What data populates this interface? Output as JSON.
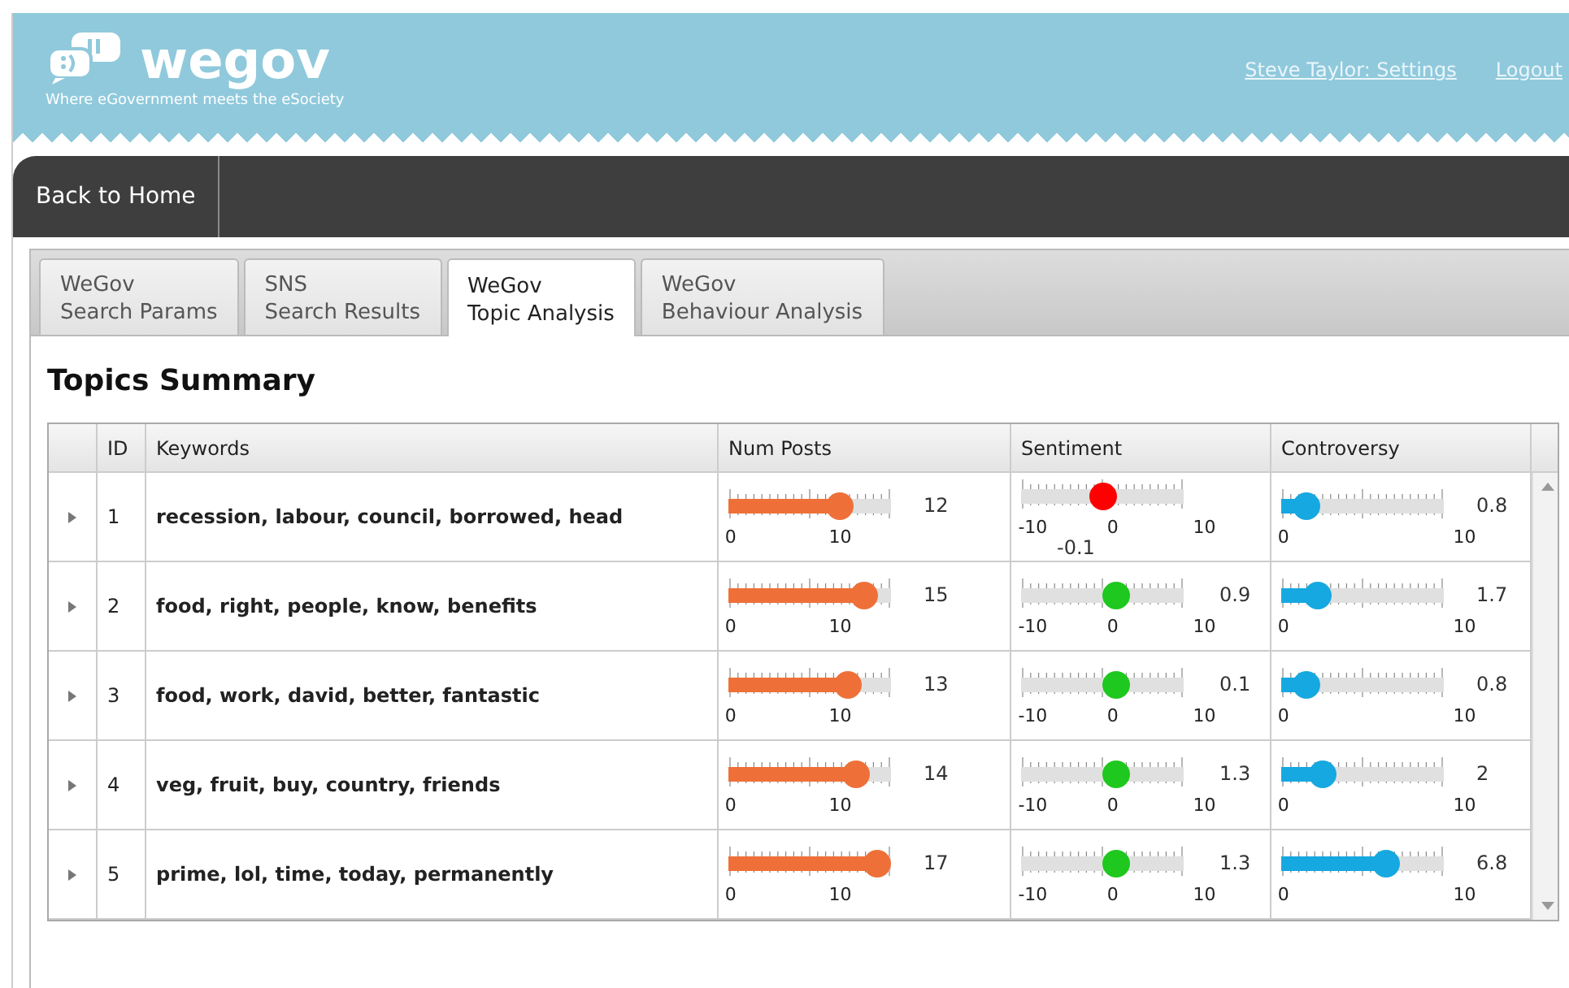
{
  "header": {
    "logo_text": "wegov",
    "tagline": "Where eGovernment meets the eSociety",
    "links": [
      "Steve Taylor: Settings",
      "Logout"
    ]
  },
  "nav": {
    "items": [
      "Back to Home"
    ]
  },
  "tabs": [
    {
      "line1": "WeGov",
      "line2": "Search Params",
      "selected": false
    },
    {
      "line1": "SNS",
      "line2": "Search Results",
      "selected": false
    },
    {
      "line1": "WeGov",
      "line2": "Topic Analysis",
      "selected": true
    },
    {
      "line1": "WeGov",
      "line2": "Behaviour Analysis",
      "selected": false
    }
  ],
  "section_title": "Topics Summary",
  "table": {
    "columns": [
      "ID",
      "Keywords",
      "Num Posts",
      "Sentiment",
      "Controversy"
    ],
    "rows": [
      {
        "expanded": false,
        "id": "1",
        "keywords": "recession, labour, council, borrowed, head",
        "num_posts": {
          "level": 0.72,
          "reading": "12",
          "tick_labels": [
            "0",
            "10"
          ]
        },
        "sentiment": {
          "level": 0.5,
          "color": "#ff0000",
          "reading": "-0.1",
          "reading_below": true,
          "tick_labels": [
            "-10",
            "0",
            "10"
          ]
        },
        "controversy": {
          "level": 0.08,
          "reading": "0.8",
          "tick_labels": [
            "0",
            "10"
          ]
        }
      },
      {
        "expanded": false,
        "id": "2",
        "keywords": "food, right, people, know, benefits",
        "num_posts": {
          "level": 0.9,
          "reading": "15",
          "tick_labels": [
            "0",
            "10"
          ]
        },
        "sentiment": {
          "level": 0.6,
          "color": "#1ec81e",
          "reading": "0.9",
          "reading_below": false,
          "tick_labels": [
            "-10",
            "0",
            "10"
          ]
        },
        "controversy": {
          "level": 0.17,
          "reading": "1.7",
          "tick_labels": [
            "0",
            "10"
          ]
        }
      },
      {
        "expanded": false,
        "id": "3",
        "keywords": "food, work, david, better, fantastic",
        "num_posts": {
          "level": 0.78,
          "reading": "13",
          "tick_labels": [
            "0",
            "10"
          ]
        },
        "sentiment": {
          "level": 0.6,
          "color": "#1ec81e",
          "reading": "0.1",
          "reading_below": false,
          "tick_labels": [
            "-10",
            "0",
            "10"
          ]
        },
        "controversy": {
          "level": 0.08,
          "reading": "0.8",
          "tick_labels": [
            "0",
            "10"
          ]
        }
      },
      {
        "expanded": false,
        "id": "4",
        "keywords": "veg, fruit, buy, country, friends",
        "num_posts": {
          "level": 0.84,
          "reading": "14",
          "tick_labels": [
            "0",
            "10"
          ]
        },
        "sentiment": {
          "level": 0.6,
          "color": "#1ec81e",
          "reading": "1.3",
          "reading_below": false,
          "tick_labels": [
            "-10",
            "0",
            "10"
          ]
        },
        "controversy": {
          "level": 0.2,
          "reading": "2",
          "tick_labels": [
            "0",
            "10"
          ]
        }
      },
      {
        "expanded": false,
        "id": "5",
        "keywords": "prime, lol, time, today, permanently",
        "num_posts": {
          "level": 1.0,
          "reading": "17",
          "tick_labels": [
            "0",
            "10"
          ]
        },
        "sentiment": {
          "level": 0.6,
          "color": "#1ec81e",
          "reading": "1.3",
          "reading_below": false,
          "tick_labels": [
            "-10",
            "0",
            "10"
          ]
        },
        "controversy": {
          "level": 0.68,
          "reading": "6.8",
          "tick_labels": [
            "0",
            "10"
          ]
        }
      }
    ]
  }
}
